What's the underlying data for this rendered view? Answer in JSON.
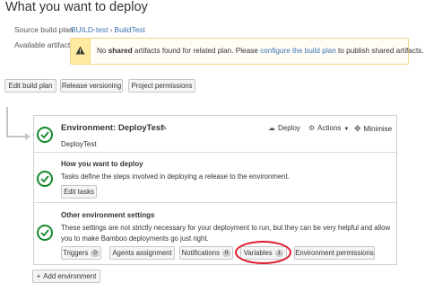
{
  "page": {
    "heading": "What you want to deploy"
  },
  "source": {
    "label": "Source build plan",
    "plan": "BUILD-test",
    "separator": "›",
    "build": "BuildTest"
  },
  "artifacts": {
    "label": "Available artifacts",
    "warning_pre": "No ",
    "warning_bold": "shared",
    "warning_mid": " artifacts found for related plan. Please ",
    "warning_link": "configure the build plan",
    "warning_post": " to publish shared artifacts."
  },
  "plan_buttons": [
    "Edit build plan",
    "Release versioning",
    "Project permissions"
  ],
  "environment": {
    "title": "Environment: DeployTest",
    "name": "DeployTest",
    "actions": {
      "deploy": "Deploy",
      "actions": "Actions",
      "minimise": "Minimise"
    }
  },
  "deploy_section": {
    "title": "How you want to deploy",
    "description": "Tasks define the steps involved in deploying a release to the environment.",
    "button": "Edit tasks"
  },
  "settings_section": {
    "title": "Other environment settings",
    "description": "These settings are not strictly necessary for your deployment to run, but they can be very helpful and allow you to make Bamboo deployments go just right.",
    "buttons": {
      "triggers": {
        "label": "Triggers",
        "count": "0"
      },
      "agents": {
        "label": "Agents assignment"
      },
      "notifications": {
        "label": "Notifications",
        "count": "0"
      },
      "variables": {
        "label": "Variables",
        "count": "1"
      },
      "permissions": {
        "label": "Environment permissions"
      }
    }
  },
  "add_environment": {
    "icon": "+",
    "label": "Add environment"
  },
  "colors": {
    "link": "#3b73af",
    "success": "#14892c",
    "warning_bg": "#ffeba0",
    "highlight": "#e0192b"
  },
  "icons": [
    "warning-icon",
    "check-icon",
    "pencil-icon",
    "deploy-icon",
    "gear-icon",
    "chevron-down-icon",
    "minimise-icon",
    "plus-icon"
  ]
}
